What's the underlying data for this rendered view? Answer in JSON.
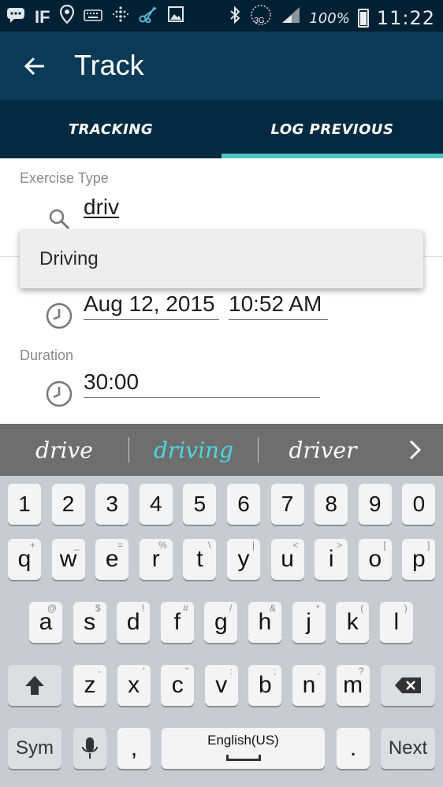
{
  "status_bar": {
    "battery_text": "100%",
    "time": "11:22",
    "network": "3G",
    "icons": [
      "message-icon",
      "ifttt-icon",
      "location-icon",
      "keyboard-icon",
      "fitbit-icon",
      "scissors-icon",
      "gallery-icon",
      "bluetooth-icon",
      "signal-icon",
      "battery-icon"
    ]
  },
  "app_bar": {
    "title": "Track"
  },
  "tabs": [
    {
      "label": "TRACKING",
      "active": false
    },
    {
      "label": "LOG PREVIOUS",
      "active": true
    }
  ],
  "form": {
    "exercise_type_label": "Exercise Type",
    "search_value": "driv",
    "dropdown_option": "Driving",
    "date_value": "Aug 12, 2015",
    "time_value": "10:52 AM",
    "duration_label": "Duration",
    "duration_value": "30:00"
  },
  "suggestions": [
    "drive",
    "driving",
    "driver"
  ],
  "keyboard": {
    "numbers": [
      "1",
      "2",
      "3",
      "4",
      "5",
      "6",
      "7",
      "8",
      "9",
      "0"
    ],
    "row1": [
      "q",
      "w",
      "e",
      "r",
      "t",
      "y",
      "u",
      "i",
      "o",
      "p"
    ],
    "row1_hints": [
      "+",
      "_",
      "=",
      "%",
      "\\",
      "|",
      "<",
      ">",
      "[",
      "]"
    ],
    "row2": [
      "a",
      "s",
      "d",
      "f",
      "g",
      "h",
      "j",
      "k",
      "l"
    ],
    "row2_hints": [
      "@",
      "$",
      "!",
      "#",
      "/",
      "&",
      "*",
      "(",
      ")"
    ],
    "row3": [
      "z",
      "x",
      "c",
      "v",
      "b",
      "n",
      "m"
    ],
    "row3_hints": [
      "-",
      "'",
      "\"",
      ":",
      ";",
      ",",
      "?"
    ],
    "sym_label": "Sym",
    "comma_label": ",",
    "space_label": "English(US)",
    "period_label": ".",
    "next_label": "Next"
  },
  "colors": {
    "status_bar": "#022033",
    "app_bar": "#0a3a55",
    "tab_bar": "#032a40",
    "tab_indicator": "#4ec8c5",
    "suggestion_highlight": "#4ad8e0"
  }
}
